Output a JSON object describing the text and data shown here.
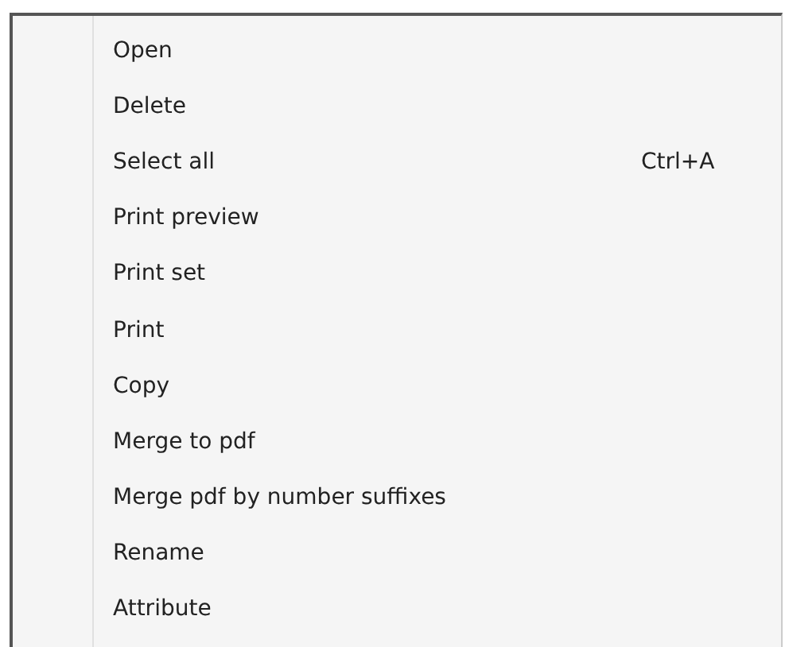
{
  "menu": {
    "items": [
      {
        "label": "Open"
      },
      {
        "label": "Delete"
      },
      {
        "label": "Select all",
        "shortcut": "Ctrl+A"
      },
      {
        "label": "Print preview"
      },
      {
        "label": "Print set"
      },
      {
        "label": "Print"
      },
      {
        "label": "Copy"
      },
      {
        "label": "Merge to pdf"
      },
      {
        "label": "Merge pdf by number suffixes"
      },
      {
        "label": "Rename"
      },
      {
        "label": "Attribute"
      }
    ]
  }
}
